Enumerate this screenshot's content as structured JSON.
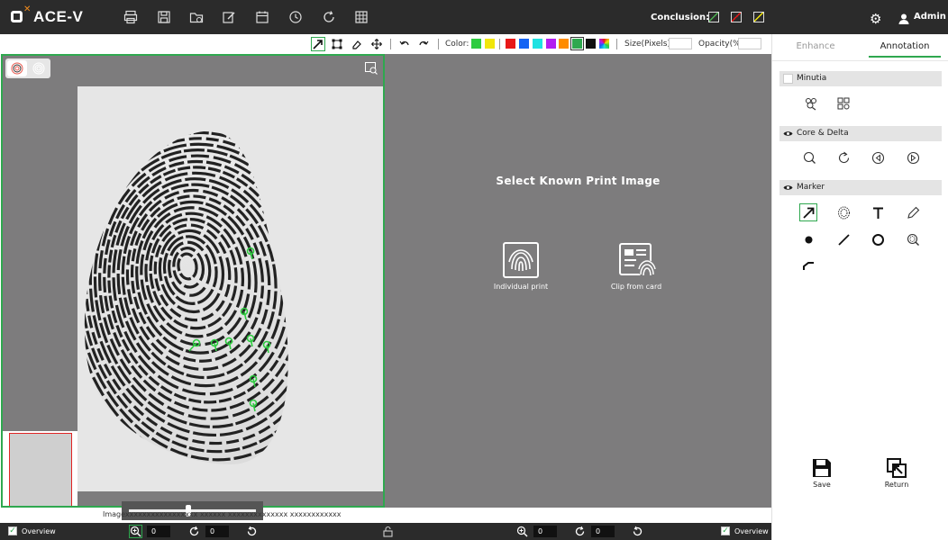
{
  "app": {
    "name": "ACE-V"
  },
  "topbar": {
    "icons": [
      "print-icon",
      "save-disk-icon",
      "folder-icon",
      "edit-icon",
      "calendar-icon",
      "history-icon",
      "refresh-icon",
      "grid-icon"
    ],
    "conclusion_label": "Conclusion:",
    "user": "Admin"
  },
  "toolbar": {
    "color_label": "Color:",
    "colors": [
      "#2ecc40",
      "#f1e60a",
      "#e81818",
      "#1464f4",
      "#1de2e2",
      "#b31ef1",
      "#ff8c00",
      "#2fa84f",
      "#111111"
    ],
    "selected_color": "#2fa84f",
    "size_label": "Size(Pixels):",
    "size_value": "",
    "opacity_label": "Opacity(%):",
    "opacity_value": ""
  },
  "left": {
    "image_label": "Imagexxxxxxxxxxxxxxxxx xxxxxx xxxxxxxxxxxxxx xxxxxxxxxxxx"
  },
  "right": {
    "title": "Select Known Print Image",
    "individual_label": "Individual print",
    "card_label": "Clip from card"
  },
  "bottom": {
    "overview_left": "Overview",
    "overview_right": "Overview",
    "zoom_left": "0",
    "rotate_left": "0",
    "zoom_right": "0",
    "rotate_right": "0"
  },
  "panel": {
    "tab_enhance": "Enhance",
    "tab_annotation": "Annotation",
    "minutia": "Minutia",
    "core_delta": "Core & Delta",
    "marker": "Marker",
    "save": "Save",
    "return": "Return"
  }
}
